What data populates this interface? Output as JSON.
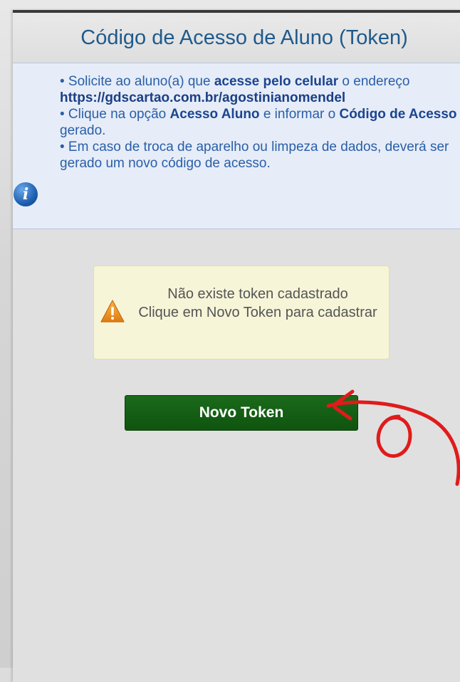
{
  "page": {
    "title": "Código de Acesso de Aluno (Token)"
  },
  "info": {
    "line1_prefix": "• Solicite ao aluno(a) que ",
    "line1_bold": "acesse pelo celular",
    "line1_suffix": " o endereço",
    "url": "https://gdscartao.com.br/agostinianomendel",
    "line2_prefix": "• Clique na opção ",
    "line2_bold1": "Acesso Aluno",
    "line2_mid": " e informar o ",
    "line2_bold2": "Código de Acesso",
    "line2_suffix": " gerado.",
    "line3": "• Em caso de troca de aparelho ou limpeza de dados, deverá ser gerado um novo código de acesso.",
    "icon": "info-icon"
  },
  "warning": {
    "line1": "Não existe token cadastrado",
    "line2": "Clique em Novo Token para cadastrar",
    "icon": "warning-icon"
  },
  "actions": {
    "new_token_label": "Novo Token"
  },
  "colors": {
    "title": "#1e5a8c",
    "info_bg": "#e6edf8",
    "warning_bg": "#f6f5d8",
    "button_bg": "#145f14",
    "annotation_arrow": "#e01b1b"
  }
}
